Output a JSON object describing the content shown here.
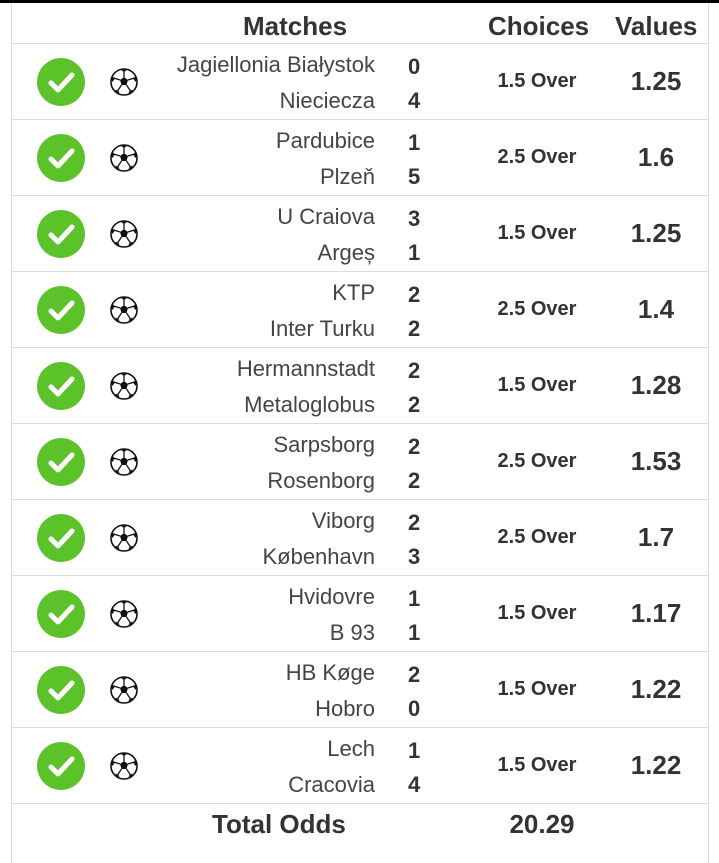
{
  "header": {
    "matches": "Matches",
    "choices": "Choices",
    "values": "Values"
  },
  "rows": [
    {
      "home": "Jagiellonia Białystok",
      "away": "Nieciecza",
      "home_score": "0",
      "away_score": "4",
      "choice": "1.5 Over",
      "value": "1.25"
    },
    {
      "home": "Pardubice",
      "away": "Plzeň",
      "home_score": "1",
      "away_score": "5",
      "choice": "2.5 Over",
      "value": "1.6"
    },
    {
      "home": "U Craiova",
      "away": "Argeș",
      "home_score": "3",
      "away_score": "1",
      "choice": "1.5 Over",
      "value": "1.25"
    },
    {
      "home": "KTP",
      "away": "Inter Turku",
      "home_score": "2",
      "away_score": "2",
      "choice": "2.5 Over",
      "value": "1.4"
    },
    {
      "home": "Hermannstadt",
      "away": "Metaloglobus",
      "home_score": "2",
      "away_score": "2",
      "choice": "1.5 Over",
      "value": "1.28"
    },
    {
      "home": "Sarpsborg",
      "away": "Rosenborg",
      "home_score": "2",
      "away_score": "2",
      "choice": "2.5 Over",
      "value": "1.53"
    },
    {
      "home": "Viborg",
      "away": "København",
      "home_score": "2",
      "away_score": "3",
      "choice": "2.5 Over",
      "value": "1.7"
    },
    {
      "home": "Hvidovre",
      "away": "B 93",
      "home_score": "1",
      "away_score": "1",
      "choice": "1.5 Over",
      "value": "1.17"
    },
    {
      "home": "HB Køge",
      "away": "Hobro",
      "home_score": "2",
      "away_score": "0",
      "choice": "1.5 Over",
      "value": "1.22"
    },
    {
      "home": "Lech",
      "away": "Cracovia",
      "home_score": "1",
      "away_score": "4",
      "choice": "1.5 Over",
      "value": "1.22"
    }
  ],
  "footer": {
    "total_label": "Total Odds",
    "total_value": "20.29"
  },
  "icons": {
    "status": "check-circle-icon",
    "sport": "soccer-ball-icon"
  },
  "colors": {
    "success": "#5cc22a"
  }
}
